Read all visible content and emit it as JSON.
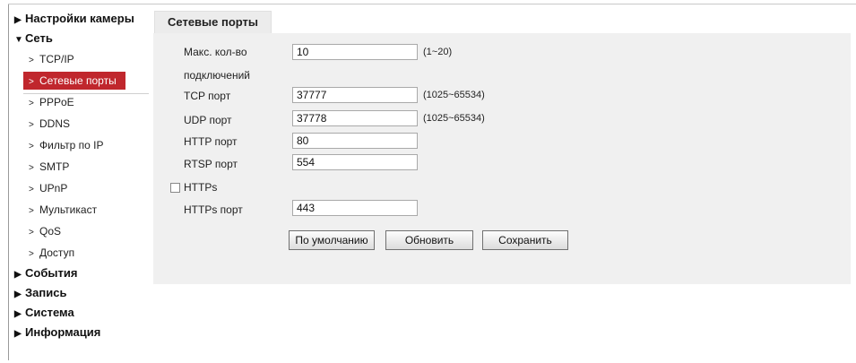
{
  "sidebar": {
    "camera_settings": "Настройки камеры",
    "network": "Сеть",
    "network_items": [
      {
        "label": "TCP/IP"
      },
      {
        "label": "Сетевые порты"
      },
      {
        "label": "PPPoE"
      },
      {
        "label": "DDNS"
      },
      {
        "label": "Фильтр по IP"
      },
      {
        "label": "SMTP"
      },
      {
        "label": "UPnP"
      },
      {
        "label": "Мультикаст"
      },
      {
        "label": "QoS"
      },
      {
        "label": "Доступ"
      }
    ],
    "events": "События",
    "record": "Запись",
    "system": "Система",
    "info": "Информация"
  },
  "icons": {
    "collapsed_arrow": "▶",
    "expanded_arrow": "▼",
    "chevron": ">"
  },
  "tab": {
    "title": "Сетевые порты"
  },
  "form": {
    "max_conn_label_1": "Макс. кол-во",
    "max_conn_label_2": "подключений",
    "max_conn_value": "10",
    "max_conn_range": "(1~20)",
    "tcp_label": "TCP порт",
    "tcp_value": "37777",
    "tcp_range": "(1025~65534)",
    "udp_label": "UDP порт",
    "udp_value": "37778",
    "udp_range": "(1025~65534)",
    "http_label": "HTTP порт",
    "http_value": "80",
    "rtsp_label": "RTSP порт",
    "rtsp_value": "554",
    "https_check_label": "HTTPs",
    "https_checked": false,
    "https_port_label": "HTTPs порт",
    "https_port_value": "443"
  },
  "buttons": {
    "default": "По умолчанию",
    "refresh": "Обновить",
    "save": "Сохранить"
  },
  "colors": {
    "active_item_bg": "#c0272d",
    "panel_bg": "#f0f0f0"
  }
}
